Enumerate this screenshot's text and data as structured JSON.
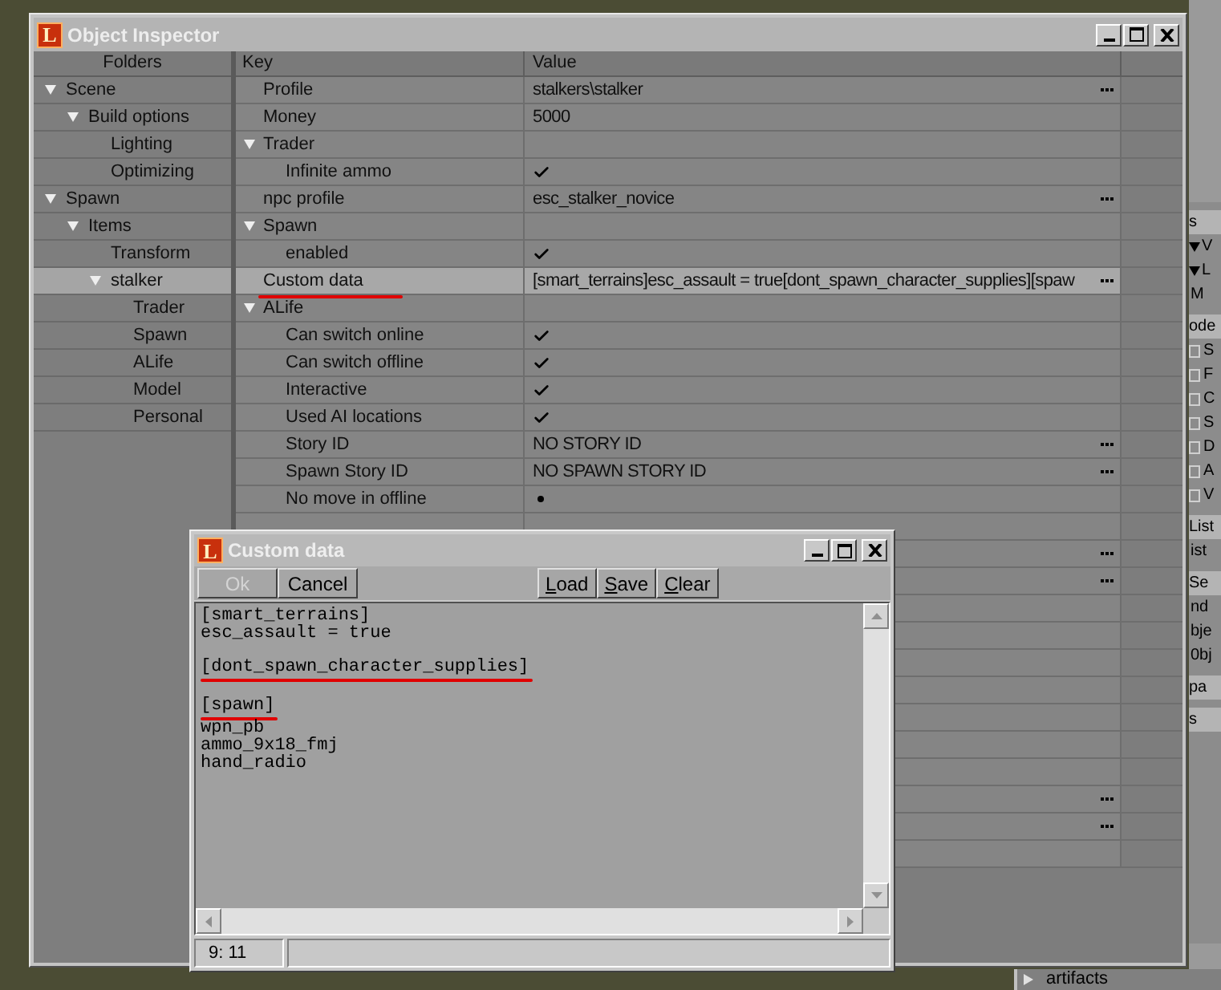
{
  "inspector": {
    "logo": "L",
    "title": "Object Inspector",
    "folders_header": "Folders",
    "folders": [
      {
        "label": "Scene",
        "expanded": true,
        "selected": false,
        "children": [
          {
            "label": "Build options",
            "expanded": true,
            "selected": false,
            "children": [
              {
                "label": "Lighting",
                "selected": false
              },
              {
                "label": "Optimizing",
                "selected": false
              }
            ]
          }
        ]
      },
      {
        "label": "Spawn",
        "expanded": true,
        "selected": false,
        "children": [
          {
            "label": "Items",
            "expanded": true,
            "selected": false,
            "children": [
              {
                "label": "Transform",
                "selected": false
              },
              {
                "label": "stalker",
                "expanded": true,
                "selected": true,
                "children": [
                  {
                    "label": "Trader",
                    "selected": false
                  },
                  {
                    "label": "Spawn",
                    "selected": false
                  },
                  {
                    "label": "ALife",
                    "selected": false
                  },
                  {
                    "label": "Model",
                    "selected": false
                  },
                  {
                    "label": "Personal",
                    "selected": false
                  }
                ]
              }
            ]
          }
        ]
      }
    ],
    "columns": [
      "Key",
      "Value"
    ],
    "rows": [
      {
        "kind": "text",
        "key": "Profile",
        "value": "stalkers\\stalker",
        "button": true,
        "selected": false,
        "annotated": false
      },
      {
        "kind": "text",
        "key": "Money",
        "value": "5000",
        "button": false,
        "selected": false,
        "annotated": false
      },
      {
        "kind": "group",
        "key": "Trader",
        "expanded": true,
        "selected": false,
        "annotated": false,
        "children": [
          {
            "kind": "bool",
            "key": "Infinite ammo",
            "checked": true,
            "selected": false,
            "annotated": false
          }
        ]
      },
      {
        "kind": "text",
        "key": "npc profile",
        "value": "esc_stalker_novice",
        "button": true,
        "selected": false,
        "annotated": false
      },
      {
        "kind": "group",
        "key": "Spawn",
        "expanded": true,
        "selected": false,
        "annotated": false,
        "children": [
          {
            "kind": "bool",
            "key": "enabled",
            "checked": true,
            "selected": false,
            "annotated": false
          }
        ]
      },
      {
        "kind": "text",
        "key": "Custom data",
        "value": "[smart_terrains]esc_assault = true[dont_spawn_character_supplies][spaw",
        "button": true,
        "selected": true,
        "annotated": true
      },
      {
        "kind": "group",
        "key": "ALife",
        "expanded": true,
        "selected": false,
        "annotated": false,
        "children": [
          {
            "kind": "bool",
            "key": "Can switch online",
            "checked": true,
            "selected": false,
            "annotated": false
          },
          {
            "kind": "bool",
            "key": "Can switch offline",
            "checked": true,
            "selected": false,
            "annotated": false
          },
          {
            "kind": "bool",
            "key": "Interactive",
            "checked": true,
            "selected": false,
            "annotated": false
          },
          {
            "kind": "bool",
            "key": "Used AI locations",
            "checked": true,
            "selected": false,
            "annotated": false
          },
          {
            "kind": "text",
            "key": "Story ID",
            "value": "NO STORY ID",
            "button": true,
            "selected": false,
            "annotated": false
          },
          {
            "kind": "text",
            "key": "Spawn Story ID",
            "value": "NO SPAWN STORY ID",
            "button": true,
            "selected": false,
            "annotated": false
          },
          {
            "kind": "bool",
            "key": "No move in offline",
            "checked": false,
            "selected": false,
            "annotated": false
          }
        ]
      }
    ],
    "hidden_rows": [
      {
        "button": false
      },
      {
        "button": true
      },
      {
        "button": true
      },
      {
        "button": false
      },
      {
        "button": false
      },
      {
        "button": false
      },
      {
        "button": false
      },
      {
        "button": false
      },
      {
        "button": false
      },
      {
        "button": false
      },
      {
        "button": true
      },
      {
        "button": true
      },
      {
        "button": false
      }
    ]
  },
  "dialog": {
    "logo": "L",
    "title": "Custom data",
    "buttons_left": [
      {
        "label": "Ok",
        "disabled": true
      },
      {
        "label": "Cancel",
        "disabled": false
      }
    ],
    "buttons_right": [
      {
        "label": "Load",
        "mnemonic": true
      },
      {
        "label": "Save",
        "mnemonic": true
      },
      {
        "label": "Clear",
        "mnemonic": true
      }
    ],
    "paragraphs": [
      [
        {
          "text": "[smart_terrains]",
          "annotated": false
        },
        {
          "text": "esc_assault = true",
          "annotated": false
        }
      ],
      [
        {
          "text": "[dont_spawn_character_supplies]",
          "annotated": true
        }
      ],
      [
        {
          "text": "[spawn]",
          "annotated": true
        },
        {
          "text": "wpn_pb",
          "annotated": false
        },
        {
          "text": "ammo_9x18_fmj",
          "annotated": false
        },
        {
          "text": "hand_radio",
          "annotated": false
        }
      ]
    ],
    "status": "9: 11"
  },
  "side_panel": [
    {
      "kind": "header",
      "label": "s"
    },
    {
      "kind": "tree",
      "label": "V"
    },
    {
      "kind": "tree",
      "label": "L"
    },
    {
      "kind": "text",
      "label": "M"
    },
    {
      "kind": "header",
      "label": "ode"
    },
    {
      "kind": "check",
      "label": "S",
      "checked": false
    },
    {
      "kind": "check",
      "label": "F",
      "checked": false
    },
    {
      "kind": "check",
      "label": "C",
      "checked": false
    },
    {
      "kind": "check",
      "label": "S",
      "checked": false
    },
    {
      "kind": "check",
      "label": "D",
      "checked": false
    },
    {
      "kind": "check",
      "label": "A",
      "checked": false
    },
    {
      "kind": "check",
      "label": "V",
      "checked": false
    },
    {
      "kind": "header",
      "label": "List"
    },
    {
      "kind": "text",
      "label": "ist"
    },
    {
      "kind": "header",
      "label": "Se"
    },
    {
      "kind": "text",
      "label": "nd"
    },
    {
      "kind": "text",
      "label": "bje"
    },
    {
      "kind": "text",
      "label": "0bj"
    },
    {
      "kind": "header",
      "label": "pa"
    },
    {
      "kind": "header",
      "label": "s"
    }
  ],
  "bottom_tree": [
    {
      "label": "artifacts"
    }
  ]
}
